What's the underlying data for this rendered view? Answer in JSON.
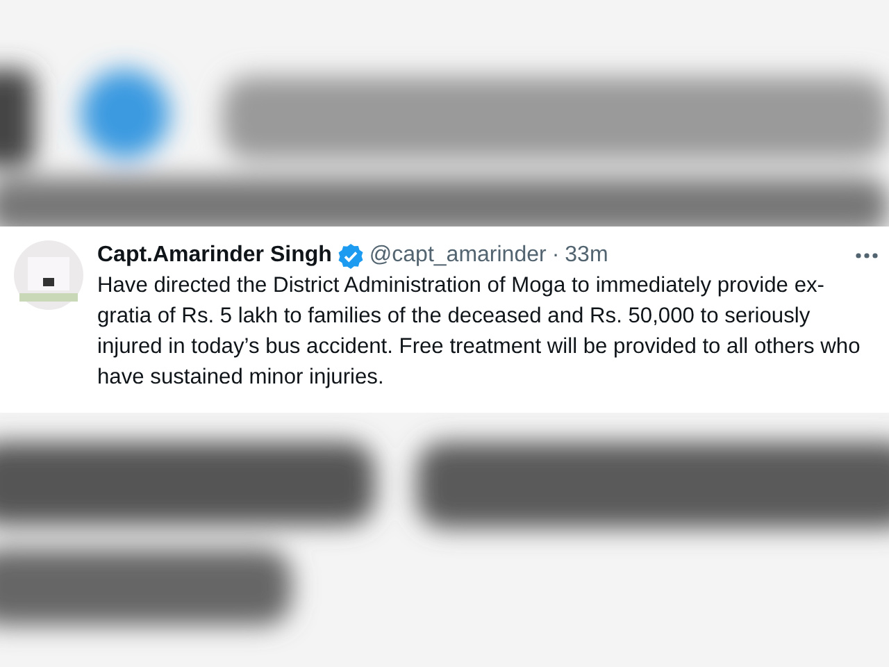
{
  "tweet": {
    "author": "Capt.Amarinder Singh",
    "verified": true,
    "handle": "@capt_amarinder",
    "separator": "·",
    "time": "33m",
    "text": "Have directed the District Administration of Moga to immediately provide ex-gratia of Rs. 5 lakh to families of the deceased and Rs. 50,000 to seriously injured in today’s bus accident. Free treatment will be provided to all others who have sustained minor injuries."
  }
}
